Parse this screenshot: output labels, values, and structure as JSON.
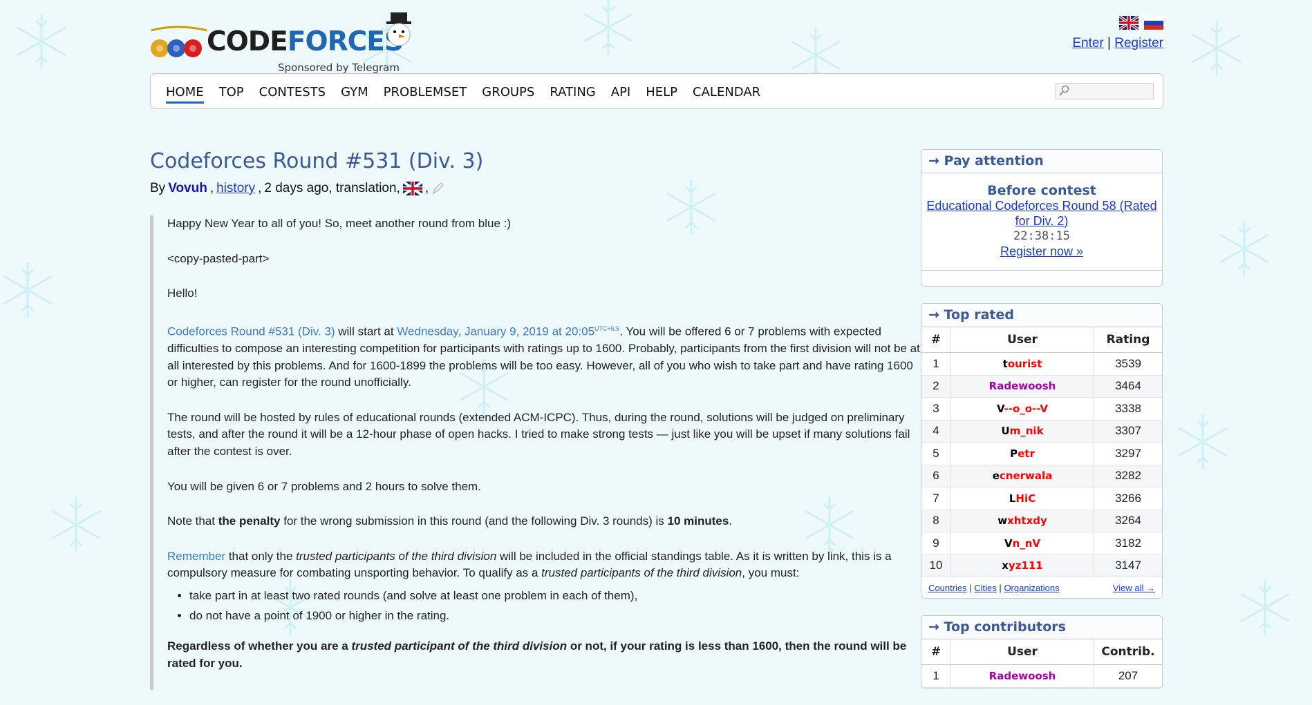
{
  "header": {
    "logo_text_main": "CODE",
    "logo_text_accent": "FORCES",
    "logo_sub": "Sponsored by Telegram",
    "enter": "Enter",
    "separator": "|",
    "register": "Register",
    "flags": [
      "uk-flag-icon",
      "russia-flag-icon"
    ]
  },
  "menu": {
    "items": [
      "HOME",
      "TOP",
      "CONTESTS",
      "GYM",
      "PROBLEMSET",
      "GROUPS",
      "RATING",
      "API",
      "HELP",
      "CALENDAR"
    ],
    "active": "HOME",
    "search_placeholder": ""
  },
  "post": {
    "title": "Codeforces Round #531 (Div. 3)",
    "by": "By",
    "author": "Vovuh",
    "history": "history",
    "time": "2 days ago, translation,",
    "p1": "Happy New Year to all of you! So, meet another round from blue :)",
    "p2": "<copy-pasted-part>",
    "p3": "Hello!",
    "p4_link": "Codeforces Round #531 (Div. 3)",
    "p4_a": " will start at ",
    "p4_date": "Wednesday, January 9, 2019 at 20:05",
    "p4_tz": "UTC+5.5",
    "p4_b": ". You will be offered 6 or 7 problems with expected difficulties to compose an interesting competition for participants with ratings up to 1600. Probably, participants from the first division will not be at all interested by this problems. And for 1600-1899 the problems will be too easy. However, all of you who wish to take part and have rating 1600 or higher, can register for the round unofficially.",
    "p5": "The round will be hosted by rules of educational rounds (extended ACM-ICPC). Thus, during the round, solutions will be judged on preliminary tests, and after the round it will be a 12-hour phase of open hacks. I tried to make strong tests — just like you will be upset if many solutions fail after the contest is over.",
    "p6": "You will be given 6 or 7 problems and 2 hours to solve them.",
    "p7_a": "Note that ",
    "p7_b": "the penalty",
    "p7_c": " for the wrong submission in this round (and the following Div. 3 rounds) is ",
    "p7_d": "10 minutes",
    "p7_e": ".",
    "p8_link": "Remember",
    "p8_a": " that only the ",
    "p8_b": "trusted participants of the third division",
    "p8_c": " will be included in the official standings table. As it is written by link, this is a compulsory measure for combating unsporting behavior. To qualify as a ",
    "p8_d": "trusted participants of the third division",
    "p8_e": ", you must:",
    "li1": "take part in at least two rated rounds (and solve at least one problem in each of them),",
    "li2": "do not have a point of 1900 or higher in the rating.",
    "p9_a": "Regardless of whether you are a ",
    "p9_b": "trusted participant of the third division",
    "p9_c": " or not, if your rating is less than 1600, then the round will be rated for you."
  },
  "sidebar": {
    "pay": {
      "head": "→ Pay attention",
      "before": "Before contest",
      "contest": "Educational Codeforces Round 58 (Rated for Div. 2)",
      "timer": "22:38:15",
      "register": "Register now »"
    },
    "top_rated": {
      "head": "→ Top rated",
      "cols": [
        "#",
        "User",
        "Rating"
      ],
      "rows": [
        {
          "n": "1",
          "first": "t",
          "rest": "ourist",
          "rating": "3539",
          "style": "legend"
        },
        {
          "n": "2",
          "first": "",
          "rest": "Radewoosh",
          "rating": "3464",
          "style": "purple"
        },
        {
          "n": "3",
          "first": "V",
          "rest": "--o_o--V",
          "rating": "3338",
          "style": "legend"
        },
        {
          "n": "4",
          "first": "U",
          "rest": "m_nik",
          "rating": "3307",
          "style": "legend"
        },
        {
          "n": "5",
          "first": "P",
          "rest": "etr",
          "rating": "3297",
          "style": "legend"
        },
        {
          "n": "6",
          "first": "e",
          "rest": "cnerwala",
          "rating": "3282",
          "style": "legend"
        },
        {
          "n": "7",
          "first": "L",
          "rest": "HiC",
          "rating": "3266",
          "style": "legend"
        },
        {
          "n": "8",
          "first": "w",
          "rest": "xhtxdy",
          "rating": "3264",
          "style": "legend"
        },
        {
          "n": "9",
          "first": "V",
          "rest": "n_nV",
          "rating": "3182",
          "style": "legend"
        },
        {
          "n": "10",
          "first": "x",
          "rest": "yz111",
          "rating": "3147",
          "style": "legend"
        }
      ],
      "links": [
        "Countries",
        "Cities",
        "Organizations"
      ],
      "sep": "|",
      "view_all": "View all →"
    },
    "top_contrib": {
      "head": "→ Top contributors",
      "cols": [
        "#",
        "User",
        "Contrib."
      ],
      "rows": [
        {
          "n": "1",
          "user": "Radewoosh",
          "contrib": "207"
        }
      ]
    }
  },
  "colors": {
    "accent": "#3b5998",
    "link": "#1a3ad6",
    "legend_red": "#ff0000",
    "purple": "#aa00aa",
    "background": "#eef9fc"
  }
}
